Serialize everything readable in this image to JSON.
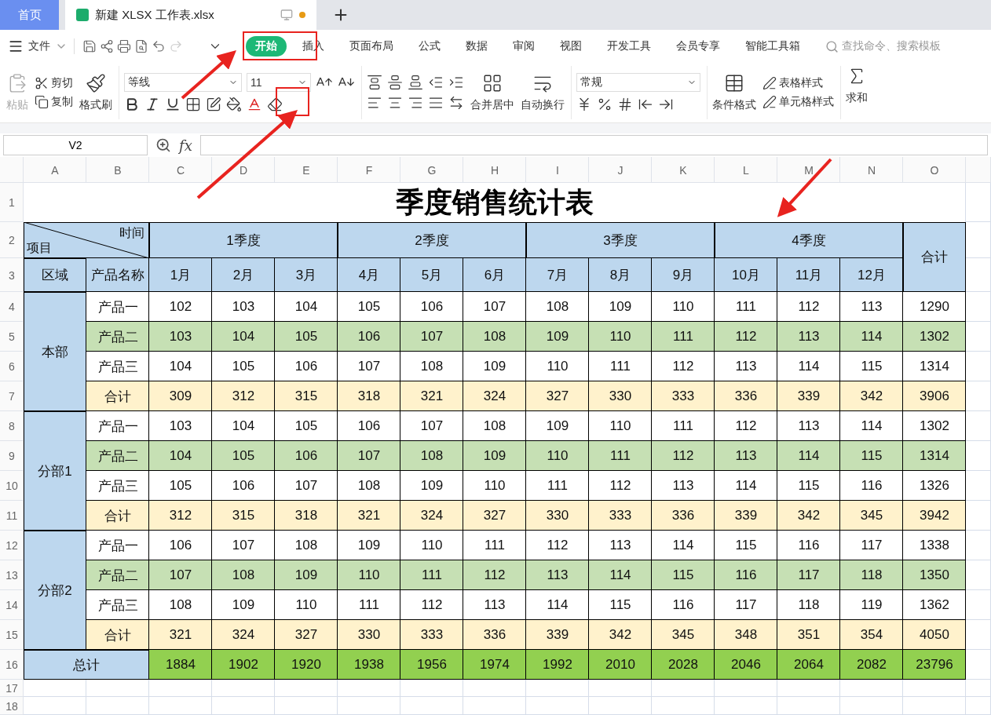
{
  "tabs": [
    {
      "label": "首页",
      "kind": "home",
      "selected": false
    },
    {
      "label": "新建 XLSX 工作表.xlsx",
      "kind": "file",
      "selected": true,
      "unsaved": true
    }
  ],
  "menu": {
    "file": "文件",
    "tabs": [
      {
        "label": "开始",
        "selected": true
      },
      {
        "label": "插入",
        "selected": false
      },
      {
        "label": "页面布局",
        "selected": false
      },
      {
        "label": "公式",
        "selected": false
      },
      {
        "label": "数据",
        "selected": false
      },
      {
        "label": "审阅",
        "selected": false
      },
      {
        "label": "视图",
        "selected": false
      },
      {
        "label": "开发工具",
        "selected": false
      },
      {
        "label": "会员专享",
        "selected": false
      },
      {
        "label": "智能工具箱",
        "selected": false
      }
    ],
    "search_placeholder": "查找命令、搜索模板"
  },
  "ribbon": {
    "paste": {
      "label": "粘贴",
      "disabled": true
    },
    "cut": "剪切",
    "copy": "复制",
    "format_painter": "格式刷",
    "font_name": "等线",
    "font_size": "11",
    "merge_center": "合并居中",
    "wrap_text": "自动换行",
    "number_format": "常规",
    "conditional_format": "条件格式",
    "table_style": "表格样式",
    "cell_style": "单元格样式",
    "sum": "求和"
  },
  "formula_bar": {
    "cell_ref": "V2",
    "fx": "fx"
  },
  "sheet": {
    "columns": [
      "A",
      "B",
      "C",
      "D",
      "E",
      "F",
      "G",
      "H",
      "I",
      "J",
      "K",
      "L",
      "M",
      "N",
      "O"
    ],
    "row_numbers": [
      "1",
      "2",
      "3",
      "4",
      "5",
      "6",
      "7",
      "8",
      "9",
      "10",
      "11",
      "12",
      "13",
      "14",
      "15",
      "16",
      "17",
      "18"
    ],
    "title": "季度销售统计表",
    "header": {
      "diag_top": "时间",
      "diag_bottom": "项目",
      "quarters": [
        "1季度",
        "2季度",
        "3季度",
        "4季度"
      ],
      "total": "合计",
      "region": "区域",
      "product": "产品名称",
      "months": [
        "1月",
        "2月",
        "3月",
        "4月",
        "5月",
        "6月",
        "7月",
        "8月",
        "9月",
        "10月",
        "11月",
        "12月"
      ]
    },
    "groups": [
      {
        "region": "本部",
        "rows": [
          {
            "kind": "plain",
            "product": "产品一",
            "values": [
              "102",
              "103",
              "104",
              "105",
              "106",
              "107",
              "108",
              "109",
              "110",
              "111",
              "112",
              "113"
            ],
            "total": "1290"
          },
          {
            "kind": "highlight",
            "product": "产品二",
            "values": [
              "103",
              "104",
              "105",
              "106",
              "107",
              "108",
              "109",
              "110",
              "111",
              "112",
              "113",
              "114"
            ],
            "total": "1302"
          },
          {
            "kind": "plain",
            "product": "产品三",
            "values": [
              "104",
              "105",
              "106",
              "107",
              "108",
              "109",
              "110",
              "111",
              "112",
              "113",
              "114",
              "115"
            ],
            "total": "1314"
          },
          {
            "kind": "subtotal",
            "product": "合计",
            "values": [
              "309",
              "312",
              "315",
              "318",
              "321",
              "324",
              "327",
              "330",
              "333",
              "336",
              "339",
              "342"
            ],
            "total": "3906"
          }
        ]
      },
      {
        "region": "分部1",
        "rows": [
          {
            "kind": "plain",
            "product": "产品一",
            "values": [
              "103",
              "104",
              "105",
              "106",
              "107",
              "108",
              "109",
              "110",
              "111",
              "112",
              "113",
              "114"
            ],
            "total": "1302"
          },
          {
            "kind": "highlight",
            "product": "产品二",
            "values": [
              "104",
              "105",
              "106",
              "107",
              "108",
              "109",
              "110",
              "111",
              "112",
              "113",
              "114",
              "115"
            ],
            "total": "1314"
          },
          {
            "kind": "plain",
            "product": "产品三",
            "values": [
              "105",
              "106",
              "107",
              "108",
              "109",
              "110",
              "111",
              "112",
              "113",
              "114",
              "115",
              "116"
            ],
            "total": "1326"
          },
          {
            "kind": "subtotal",
            "product": "合计",
            "values": [
              "312",
              "315",
              "318",
              "321",
              "324",
              "327",
              "330",
              "333",
              "336",
              "339",
              "342",
              "345"
            ],
            "total": "3942"
          }
        ]
      },
      {
        "region": "分部2",
        "rows": [
          {
            "kind": "plain",
            "product": "产品一",
            "values": [
              "106",
              "107",
              "108",
              "109",
              "110",
              "111",
              "112",
              "113",
              "114",
              "115",
              "116",
              "117"
            ],
            "total": "1338"
          },
          {
            "kind": "highlight",
            "product": "产品二",
            "values": [
              "107",
              "108",
              "109",
              "110",
              "111",
              "112",
              "113",
              "114",
              "115",
              "116",
              "117",
              "118"
            ],
            "total": "1350"
          },
          {
            "kind": "plain",
            "product": "产品三",
            "values": [
              "108",
              "109",
              "110",
              "111",
              "112",
              "113",
              "114",
              "115",
              "116",
              "117",
              "118",
              "119"
            ],
            "total": "1362"
          },
          {
            "kind": "subtotal",
            "product": "合计",
            "values": [
              "321",
              "324",
              "327",
              "330",
              "333",
              "336",
              "339",
              "342",
              "345",
              "348",
              "351",
              "354"
            ],
            "total": "4050"
          }
        ]
      }
    ],
    "grand_total": {
      "label": "总计",
      "values": [
        "1884",
        "1902",
        "1920",
        "1938",
        "1956",
        "1974",
        "1992",
        "2010",
        "2028",
        "2046",
        "2064",
        "2082"
      ],
      "total": "23796"
    }
  }
}
